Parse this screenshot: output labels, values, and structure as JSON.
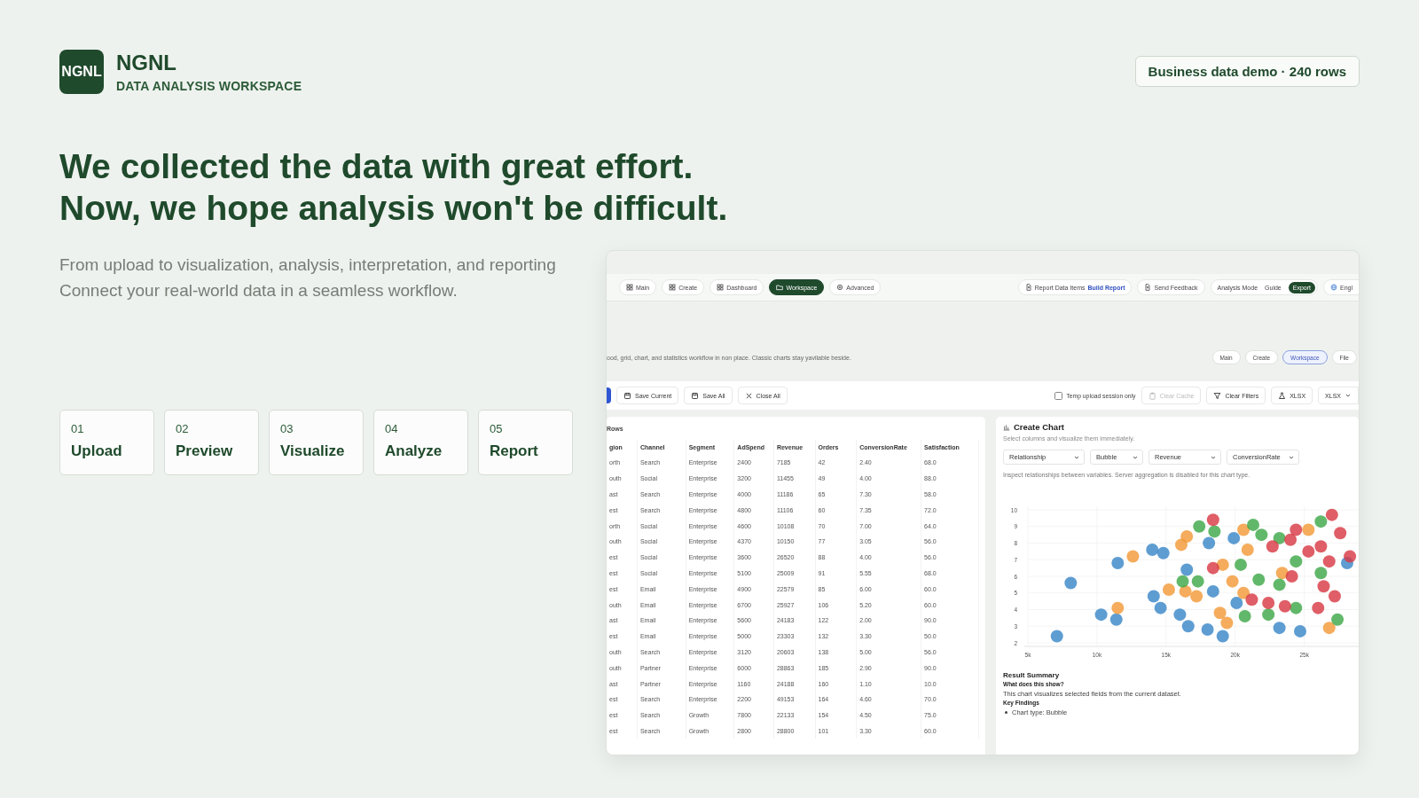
{
  "brand": {
    "logo": "NGNL",
    "name": "NGNL",
    "tagline": "DATA ANALYSIS WORKSPACE"
  },
  "badge": "Business data demo · 240 rows",
  "headline": [
    "We collected the data with great effort.",
    "Now, we hope analysis won't be difficult."
  ],
  "intro": [
    "From upload to visualization, analysis, interpretation, and reporting",
    "Connect your real-world data in a seamless workflow."
  ],
  "steps": [
    {
      "number": "01",
      "label": "Upload"
    },
    {
      "number": "02",
      "label": "Preview"
    },
    {
      "number": "03",
      "label": "Visualize"
    },
    {
      "number": "04",
      "label": "Analyze"
    },
    {
      "number": "05",
      "label": "Report"
    }
  ],
  "app": {
    "nav": [
      {
        "label": "Main",
        "selected": false
      },
      {
        "label": "Create",
        "selected": false
      },
      {
        "label": "Dashboard",
        "selected": false
      },
      {
        "label": "Workspace",
        "selected": true
      },
      {
        "label": "Advanced",
        "selected": false
      }
    ],
    "report": {
      "label": "Report Data Items",
      "action": "Build Report"
    },
    "feedback": "Send Feedback",
    "mode": {
      "label": "Analysis Mode",
      "guide": "Guide",
      "export": "Export"
    },
    "language": "Engl",
    "description": "ood, grid, chart, and statistics workflow in non place. Classic charts stay yavilable beside.",
    "view_tabs": [
      {
        "label": "Main",
        "selected": false
      },
      {
        "label": "Create",
        "selected": false
      },
      {
        "label": "Workspace",
        "selected": true
      },
      {
        "label": "File",
        "selected": false
      }
    ],
    "toolbar_left": [
      {
        "label": "Save Current",
        "disabled": false
      },
      {
        "label": "Save All",
        "disabled": false
      },
      {
        "label": "Close All",
        "disabled": false
      }
    ],
    "temp_upload": {
      "label": "Temp upload session only",
      "checked": false
    },
    "toolbar_right": [
      {
        "label": "Clear Cache",
        "disabled": true
      },
      {
        "label": "Clear Filters",
        "disabled": false
      },
      {
        "label": "XLSX",
        "disabled": false
      }
    ],
    "format_select": "XLSX",
    "table": {
      "title": "Rows",
      "columns": [
        "gion",
        "Channel",
        "Segment",
        "AdSpend",
        "Revenue",
        "Orders",
        "ConversionRate",
        "Satisfaction"
      ],
      "rows": [
        [
          "orth",
          "Search",
          "Enterprise",
          "2400",
          "7185",
          "42",
          "2.40",
          "68.0"
        ],
        [
          "outh",
          "Social",
          "Enterprise",
          "3200",
          "11455",
          "49",
          "4.00",
          "88.0"
        ],
        [
          "ast",
          "Search",
          "Enterprise",
          "4000",
          "11186",
          "65",
          "7.30",
          "58.0"
        ],
        [
          "est",
          "Search",
          "Enterprise",
          "4800",
          "11106",
          "60",
          "7.35",
          "72.0"
        ],
        [
          "orth",
          "Social",
          "Enterprise",
          "4600",
          "10108",
          "70",
          "7.00",
          "64.0"
        ],
        [
          "outh",
          "Social",
          "Enterprise",
          "4370",
          "10150",
          "77",
          "3.05",
          "56.0"
        ],
        [
          "est",
          "Social",
          "Enterprise",
          "3600",
          "26520",
          "88",
          "4.00",
          "56.0"
        ],
        [
          "est",
          "Social",
          "Enterprise",
          "5100",
          "25009",
          "91",
          "5.55",
          "68.0"
        ],
        [
          "est",
          "Email",
          "Enterprise",
          "4900",
          "22579",
          "85",
          "6.00",
          "60.0"
        ],
        [
          "outh",
          "Email",
          "Enterprise",
          "6700",
          "25927",
          "106",
          "5.20",
          "60.0"
        ],
        [
          "ast",
          "Email",
          "Enterprise",
          "5600",
          "24183",
          "122",
          "2.00",
          "90.0"
        ],
        [
          "est",
          "Email",
          "Enterprise",
          "5000",
          "23303",
          "132",
          "3.30",
          "50.0"
        ],
        [
          "outh",
          "Search",
          "Enterprise",
          "3120",
          "20603",
          "138",
          "5.00",
          "56.0"
        ],
        [
          "outh",
          "Partner",
          "Enterprise",
          "6000",
          "28863",
          "185",
          "2.90",
          "90.0"
        ],
        [
          "ast",
          "Partner",
          "Enterprise",
          "1160",
          "24188",
          "160",
          "1.10",
          "10.0"
        ],
        [
          "est",
          "Search",
          "Enterprise",
          "2200",
          "49153",
          "164",
          "4.60",
          "70.0"
        ],
        [
          "est",
          "Search",
          "Growth",
          "7800",
          "22133",
          "154",
          "4.50",
          "75.0"
        ],
        [
          "est",
          "Search",
          "Growth",
          "2800",
          "28800",
          "101",
          "3.30",
          "60.0"
        ]
      ]
    },
    "chart_panel": {
      "title": "Create Chart",
      "subtitle": "Select columns and visualize them immediately.",
      "selects": [
        "Relationship",
        "Bubble",
        "Revenue",
        "ConversionRate"
      ],
      "hint": "Inspect relationships between variables. Server aggregation is disabled for this chart type.",
      "chart_data": {
        "type": "scatter",
        "xlim": [
          5000,
          29000
        ],
        "ylim": [
          2,
          10
        ],
        "grid": true,
        "xticks": [
          {
            "value": 5000,
            "label": "5k"
          },
          {
            "value": 10000,
            "label": "10k"
          },
          {
            "value": 15000,
            "label": "15k"
          },
          {
            "value": 20000,
            "label": "20k"
          },
          {
            "value": 25000,
            "label": "25k"
          }
        ],
        "yticks": [
          2,
          3,
          4,
          5,
          6,
          7,
          8,
          9,
          10
        ],
        "series": [
          {
            "color": "#3b87c8",
            "x": [
              7100,
              8100,
              11500,
              10300,
              11400,
              14000,
              14800,
              14100,
              14600,
              16000,
              16600,
              18000,
              19100,
              18100,
              19900,
              16500,
              18400,
              20100,
              23200,
              24700,
              28100
            ],
            "values": [
              2.4,
              5.6,
              6.8,
              3.7,
              3.4,
              7.6,
              7.4,
              4.8,
              4.1,
              3.7,
              3.0,
              2.8,
              2.4,
              8.0,
              8.3,
              6.4,
              5.1,
              4.4,
              2.9,
              2.7,
              6.8
            ]
          },
          {
            "color": "#f39a38",
            "x": [
              11500,
              12600,
              15200,
              16100,
              16500,
              16400,
              17200,
              19100,
              18900,
              19400,
              20600,
              20900,
              20600,
              23400,
              25300,
              26800,
              19800
            ],
            "values": [
              4.1,
              7.2,
              5.2,
              7.9,
              8.4,
              5.1,
              4.8,
              6.7,
              3.8,
              3.2,
              8.8,
              7.6,
              5.0,
              6.2,
              8.8,
              2.9,
              5.7
            ]
          },
          {
            "color": "#3fa849",
            "x": [
              16200,
              17400,
              17300,
              18500,
              20400,
              21300,
              21900,
              21700,
              20700,
              23200,
              24400,
              24400,
              26200,
              26200,
              27400,
              23200,
              22400
            ],
            "values": [
              5.7,
              9.0,
              5.7,
              8.7,
              6.7,
              9.1,
              8.5,
              5.8,
              3.6,
              8.3,
              6.9,
              4.1,
              9.3,
              6.2,
              3.4,
              5.5,
              3.7
            ]
          },
          {
            "color": "#d83b45",
            "x": [
              18400,
              18400,
              21200,
              22400,
              22700,
              24000,
              24400,
              24100,
              23600,
              26200,
              27000,
              26800,
              27200,
              28300,
              26400,
              26000,
              27600,
              25300
            ],
            "values": [
              9.4,
              6.5,
              4.6,
              4.4,
              7.8,
              8.2,
              8.8,
              6.0,
              4.2,
              7.8,
              9.7,
              6.9,
              4.8,
              7.2,
              5.4,
              4.1,
              8.6,
              7.5
            ]
          }
        ]
      },
      "summary": {
        "title": "Result Summary",
        "question": "What does this show?",
        "answer": "This chart visualizes selected fields from the current dataset.",
        "findings_title": "Key Findings",
        "findings": [
          "Chart type: Bubble"
        ]
      }
    }
  }
}
